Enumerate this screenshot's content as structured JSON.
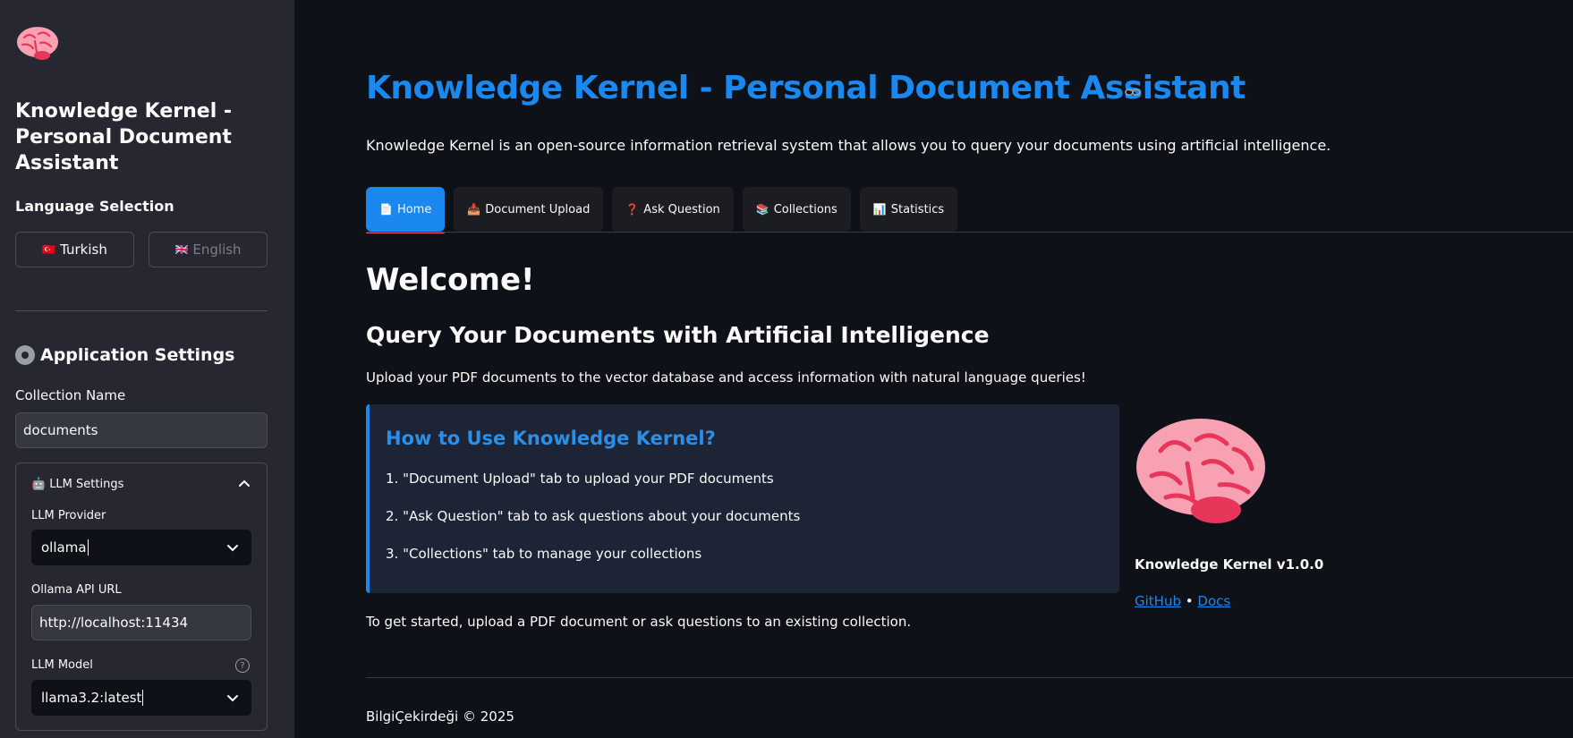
{
  "sidebar": {
    "logo_icon": "brain-icon",
    "title": "Knowledge Kernel - Personal Document Assistant",
    "language": {
      "label": "Language Selection",
      "turkish": {
        "flag": "🇹🇷",
        "label": "Turkish"
      },
      "english": {
        "flag": "🇬🇧",
        "label": "English"
      }
    },
    "settings": {
      "heading": "Application Settings",
      "icon": "gear-icon",
      "collection_label": "Collection Name",
      "collection_value": "documents"
    },
    "llm": {
      "header_icon": "🤖",
      "header": "LLM Settings",
      "provider_label": "LLM Provider",
      "provider_value": "ollama",
      "api_url_label": "Ollama API URL",
      "api_url_value": "http://localhost:11434",
      "model_label": "LLM Model",
      "model_value": "llama3.2:latest",
      "help_glyph": "?"
    }
  },
  "main": {
    "title": "Knowledge Kernel - Personal Document Assistant",
    "intro": "Knowledge Kernel is an open-source information retrieval system that allows you to query your documents using artificial intelligence.",
    "tabs": [
      {
        "icon": "📄",
        "label": "Home"
      },
      {
        "icon": "📥",
        "label": "Document Upload"
      },
      {
        "icon": "❓",
        "label": "Ask Question"
      },
      {
        "icon": "📚",
        "label": "Collections"
      },
      {
        "icon": "📊",
        "label": "Statistics"
      }
    ],
    "welcome": "Welcome!",
    "subheading": "Query Your Documents with Artificial Intelligence",
    "description": "Upload your PDF documents to the vector database and access information with natural language queries!",
    "howto": {
      "title": "How to Use Knowledge Kernel?",
      "steps": [
        "1. \"Document Upload\" tab to upload your PDF documents",
        "2. \"Ask Question\" tab to ask questions about your documents",
        "3. \"Collections\" tab to manage your collections"
      ]
    },
    "get_started": "To get started, upload a PDF document or ask questions to an existing collection.",
    "version": "Knowledge Kernel v1.0.0",
    "links": {
      "github": "GitHub",
      "separator": "•",
      "docs": "Docs"
    },
    "footer": "BilgiÇekirdeği © 2025"
  },
  "colors": {
    "accent": "#1a88ee",
    "background": "#0e1117",
    "sidebar": "#262730",
    "tab_indicator": "#ff4b4b",
    "brain": "#f0637d"
  }
}
